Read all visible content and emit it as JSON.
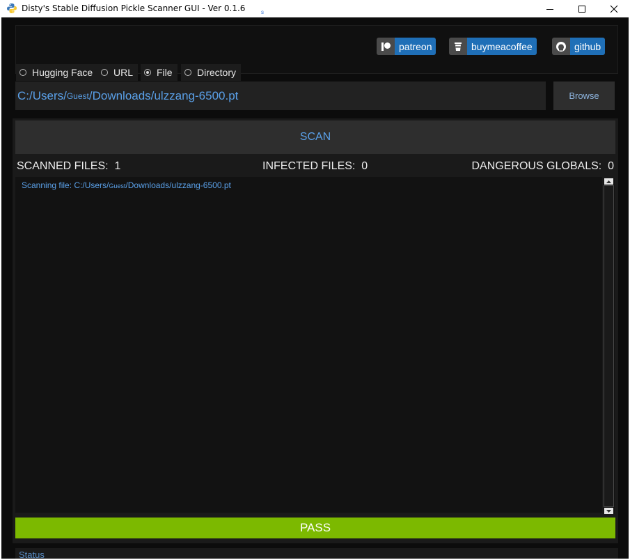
{
  "window": {
    "title": "Disty's Stable Diffusion Pickle Scanner GUI - Ver 0.1.6",
    "stray_char": "s",
    "controls": [
      "minimize",
      "maximize",
      "close"
    ]
  },
  "support_links": [
    {
      "label": "patreon",
      "icon": "patreon-icon"
    },
    {
      "label": "buymeacoffee",
      "icon": "coffee-cup-icon"
    },
    {
      "label": "github",
      "icon": "github-icon"
    }
  ],
  "source_options": [
    {
      "label": "Hugging Face",
      "selected": false
    },
    {
      "label": "URL",
      "selected": false
    },
    {
      "label": "File",
      "selected": true
    },
    {
      "label": "Directory",
      "selected": false
    }
  ],
  "path": {
    "prefix": "C:/Users/",
    "user": "Guest",
    "suffix": "/Downloads/ulzzang-6500.pt"
  },
  "browse_label": "Browse",
  "scan_label": "SCAN",
  "stats": {
    "scanned_label": "SCANNED FILES:",
    "scanned_value": "1",
    "infected_label": "INFECTED FILES:",
    "infected_value": "0",
    "dangerous_label": "DANGEROUS GLOBALS:",
    "dangerous_value": "0"
  },
  "log": {
    "prefix": "Scanning file: C:/Users/",
    "user": "Guest",
    "suffix": "/Downloads/ulzzang-6500.pt"
  },
  "result": {
    "label": "PASS",
    "color": "#7cb900"
  },
  "status_label": "Status",
  "colors": {
    "accent": "#5aa0e8",
    "button_blue": "#1f6fb7",
    "background": "#0c0c0c"
  }
}
